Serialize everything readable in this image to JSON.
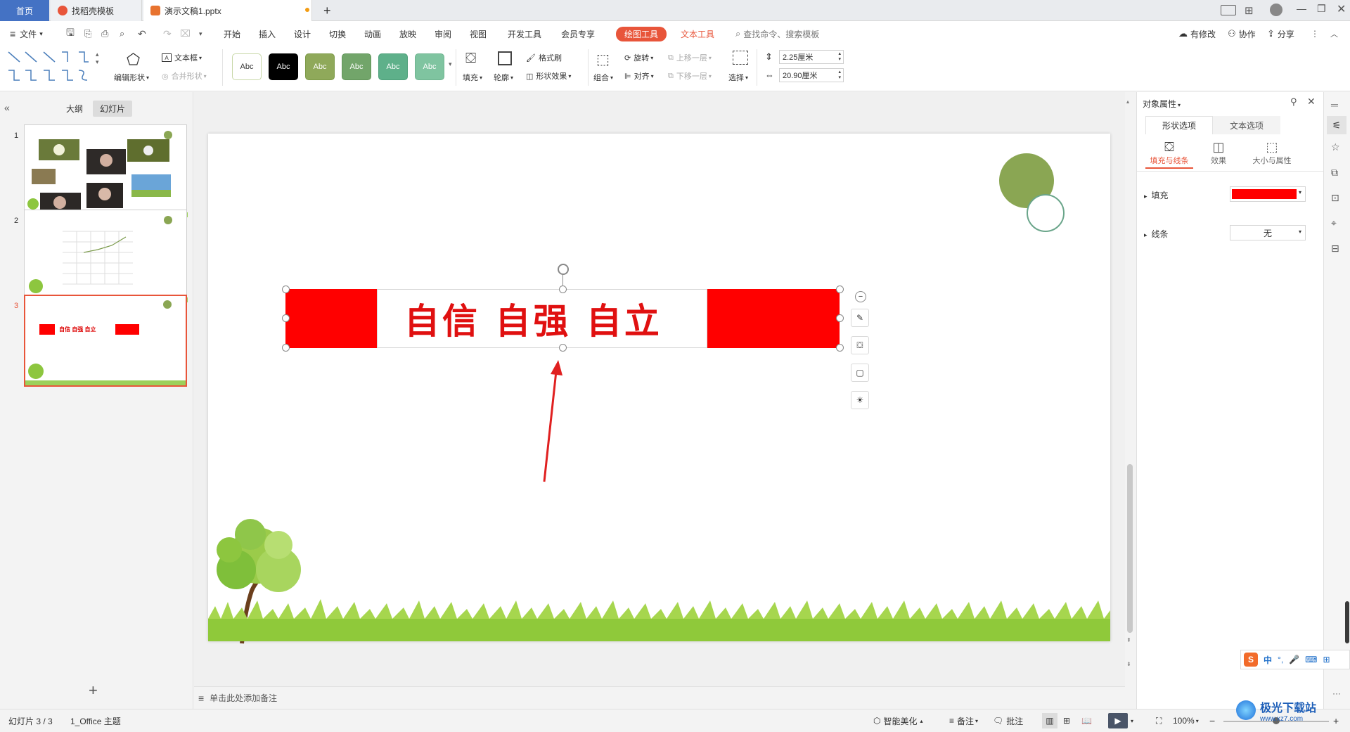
{
  "titlebar": {
    "tabs": [
      {
        "label": "首页"
      },
      {
        "label": "找稻壳模板"
      },
      {
        "label": "演示文稿1.pptx"
      }
    ],
    "new_tab": "+"
  },
  "menubar": {
    "file": "文件",
    "items": [
      "开始",
      "插入",
      "设计",
      "切换",
      "动画",
      "放映",
      "审阅",
      "视图",
      "开发工具",
      "会员专享"
    ],
    "drawing_tools": "绘图工具",
    "text_tools": "文本工具",
    "search_placeholder": "查找命令、搜索模板",
    "has_changes": "有修改",
    "collaborate": "协作",
    "share": "分享"
  },
  "ribbon": {
    "edit_shape": "编辑形状",
    "textbox": "文本框",
    "merge_shape": "合并形状",
    "shape_styles": [
      {
        "label": "Abc",
        "bg": "#ffffff",
        "fg": "#333333",
        "border": "#c8d8a8"
      },
      {
        "label": "Abc",
        "bg": "#000000",
        "fg": "#ffffff",
        "border": "#000000"
      },
      {
        "label": "Abc",
        "bg": "#8fa95a",
        "fg": "#ffffff",
        "border": "#7d9a48"
      },
      {
        "label": "Abc",
        "bg": "#72a56a",
        "fg": "#ffffff",
        "border": "#62955a"
      },
      {
        "label": "Abc",
        "bg": "#5eb08a",
        "fg": "#ffffff",
        "border": "#4ea07a"
      },
      {
        "label": "Abc",
        "bg": "#7fc4a0",
        "fg": "#ffffff",
        "border": "#6fb490"
      }
    ],
    "fill": "填充",
    "outline": "轮廓",
    "format_painter": "格式刷",
    "shape_effects": "形状效果",
    "group": "组合",
    "rotate": "旋转",
    "align": "对齐",
    "bring_forward": "上移一层",
    "send_backward": "下移一层",
    "select": "选择",
    "height_value": "2.25厘米",
    "width_value": "20.90厘米"
  },
  "leftpanel": {
    "outline_tab": "大纲",
    "slides_tab": "幻灯片",
    "slides": [
      {
        "num": "1"
      },
      {
        "num": "2"
      },
      {
        "num": "3",
        "text": "自信 自强 自立"
      }
    ],
    "add_slide": "+"
  },
  "slide": {
    "banner_text": "自信 自强 自立",
    "banner_color": "#ff0000",
    "accent_green": "#8aa653",
    "notes_placeholder": "单击此处添加备注"
  },
  "rightpanel": {
    "title": "对象属性",
    "tab_shape": "形状选项",
    "tab_text": "文本选项",
    "sub_fill_line": "填充与线条",
    "sub_effects": "效果",
    "sub_size": "大小与属性",
    "fill_label": "填充",
    "fill_color": "#ff0000",
    "line_label": "线条",
    "line_value": "无"
  },
  "statusbar": {
    "slide_info": "幻灯片 3 / 3",
    "theme": "1_Office 主题",
    "smart_beautify": "智能美化",
    "notes": "备注",
    "comments": "批注",
    "zoom": "100%",
    "ime": "中"
  },
  "watermark": {
    "site": "极光下载站",
    "url": "www.xz7.com"
  }
}
